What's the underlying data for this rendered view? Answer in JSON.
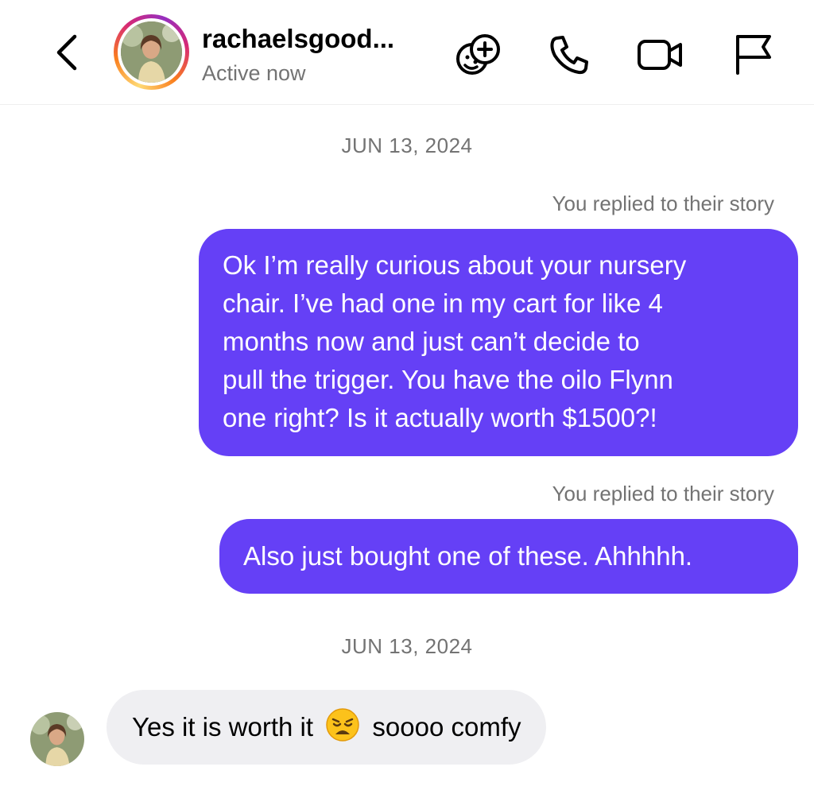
{
  "header": {
    "username": "rachaelsgood...",
    "status": "Active now",
    "icons": [
      "back-icon",
      "avatar",
      "game-icon",
      "phone-icon",
      "video-icon",
      "flag-icon"
    ]
  },
  "thread": {
    "date_1": "JUN 13, 2024",
    "reply_note_1": "You replied to their story",
    "message_1_lines": [
      "Ok I’m really curious about your nursery",
      "chair. I’ve had one in my cart for like 4",
      "months now and just can’t decide to",
      "pull the trigger. You have the oilo Flynn",
      "one right? Is it actually worth $1500?!"
    ],
    "reply_note_2": "You replied to their story",
    "message_2": "Also just bought one of these. Ahhhhh.",
    "date_2": "JUN 13, 2024",
    "reply_part_1": "Yes it is worth it",
    "reply_emoji": "weary-face-emoji",
    "reply_part_2": "soooo comfy"
  },
  "colors": {
    "outgoing_bubble": "#6540f6",
    "incoming_bubble": "#efeff2",
    "meta_text": "#737373"
  }
}
